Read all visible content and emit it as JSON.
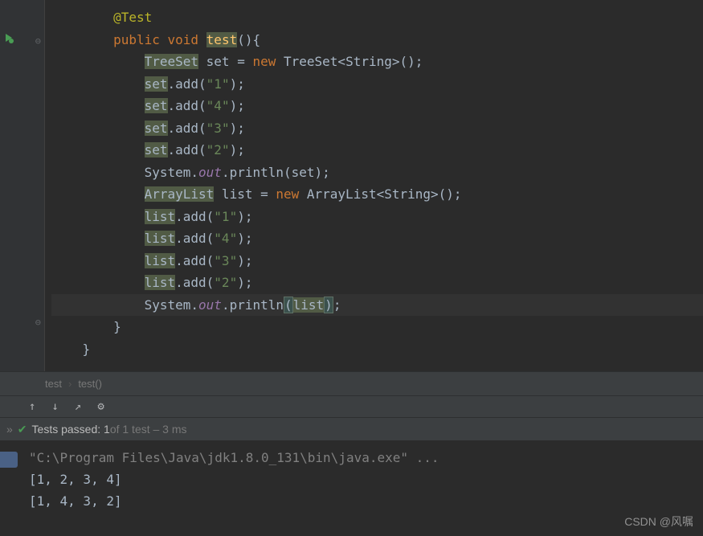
{
  "code": {
    "lines": [
      {
        "indent": 8,
        "tokens": [
          {
            "t": "@Test",
            "c": "annotation"
          }
        ]
      },
      {
        "indent": 8,
        "tokens": [
          {
            "t": "public ",
            "c": "keyword"
          },
          {
            "t": "void ",
            "c": "keyword"
          },
          {
            "t": "test",
            "c": "method-name highlight-bg"
          },
          {
            "t": "(){",
            "c": "normal"
          }
        ]
      },
      {
        "indent": 12,
        "tokens": [
          {
            "t": "TreeSet",
            "c": "normal highlight-bg"
          },
          {
            "t": " set = ",
            "c": "normal"
          },
          {
            "t": "new ",
            "c": "keyword"
          },
          {
            "t": "TreeSet<String>();",
            "c": "normal"
          }
        ]
      },
      {
        "indent": 12,
        "tokens": [
          {
            "t": "set",
            "c": "normal highlight-bg"
          },
          {
            "t": ".add(",
            "c": "normal"
          },
          {
            "t": "\"1\"",
            "c": "string"
          },
          {
            "t": ");",
            "c": "normal"
          }
        ]
      },
      {
        "indent": 12,
        "tokens": [
          {
            "t": "set",
            "c": "normal highlight-bg"
          },
          {
            "t": ".add(",
            "c": "normal"
          },
          {
            "t": "\"4\"",
            "c": "string"
          },
          {
            "t": ");",
            "c": "normal"
          }
        ]
      },
      {
        "indent": 12,
        "tokens": [
          {
            "t": "set",
            "c": "normal highlight-bg"
          },
          {
            "t": ".add(",
            "c": "normal"
          },
          {
            "t": "\"3\"",
            "c": "string"
          },
          {
            "t": ");",
            "c": "normal"
          }
        ]
      },
      {
        "indent": 12,
        "tokens": [
          {
            "t": "set",
            "c": "normal highlight-bg"
          },
          {
            "t": ".add(",
            "c": "normal"
          },
          {
            "t": "\"2\"",
            "c": "string"
          },
          {
            "t": ");",
            "c": "normal"
          }
        ]
      },
      {
        "indent": 12,
        "tokens": [
          {
            "t": "System.",
            "c": "normal"
          },
          {
            "t": "out",
            "c": "field-static"
          },
          {
            "t": ".println(set);",
            "c": "normal"
          }
        ]
      },
      {
        "indent": 12,
        "tokens": [
          {
            "t": "ArrayList",
            "c": "normal highlight-bg"
          },
          {
            "t": " list = ",
            "c": "normal"
          },
          {
            "t": "new ",
            "c": "keyword"
          },
          {
            "t": "ArrayList<String>();",
            "c": "normal"
          }
        ]
      },
      {
        "indent": 12,
        "tokens": [
          {
            "t": "list",
            "c": "normal highlight-bg"
          },
          {
            "t": ".add(",
            "c": "normal"
          },
          {
            "t": "\"1\"",
            "c": "string"
          },
          {
            "t": ");",
            "c": "normal"
          }
        ]
      },
      {
        "indent": 12,
        "tokens": [
          {
            "t": "list",
            "c": "normal highlight-bg"
          },
          {
            "t": ".add(",
            "c": "normal"
          },
          {
            "t": "\"4\"",
            "c": "string"
          },
          {
            "t": ");",
            "c": "normal"
          }
        ]
      },
      {
        "indent": 12,
        "tokens": [
          {
            "t": "list",
            "c": "normal highlight-bg"
          },
          {
            "t": ".add(",
            "c": "normal"
          },
          {
            "t": "\"3\"",
            "c": "string"
          },
          {
            "t": ");",
            "c": "normal"
          }
        ]
      },
      {
        "indent": 12,
        "tokens": [
          {
            "t": "list",
            "c": "normal highlight-bg"
          },
          {
            "t": ".add(",
            "c": "normal"
          },
          {
            "t": "\"2\"",
            "c": "string"
          },
          {
            "t": ");",
            "c": "normal"
          }
        ]
      },
      {
        "indent": 12,
        "caret": true,
        "tokens": [
          {
            "t": "System.",
            "c": "normal"
          },
          {
            "t": "out",
            "c": "field-static"
          },
          {
            "t": ".println",
            "c": "normal"
          },
          {
            "t": "(",
            "c": "normal bracket-match"
          },
          {
            "t": "list",
            "c": "normal highlight-bg"
          },
          {
            "t": ")",
            "c": "normal bracket-match"
          },
          {
            "t": ";",
            "c": "normal"
          }
        ]
      },
      {
        "indent": 8,
        "tokens": [
          {
            "t": "}",
            "c": "normal"
          }
        ]
      },
      {
        "indent": 4,
        "tokens": [
          {
            "t": "}",
            "c": "normal"
          }
        ]
      }
    ]
  },
  "breadcrumb": {
    "item1": "test",
    "item2": "test()"
  },
  "test_status": {
    "passed_text": "Tests passed: 1",
    "of_text": " of 1 test – 3 ms"
  },
  "console_lines": [
    {
      "text": "\"C:\\Program Files\\Java\\jdk1.8.0_131\\bin\\java.exe\" ...",
      "muted": true
    },
    {
      "text": "[1, 2, 3, 4]",
      "muted": false
    },
    {
      "text": "[1, 4, 3, 2]",
      "muted": false
    }
  ],
  "watermark": "CSDN @风嘱"
}
